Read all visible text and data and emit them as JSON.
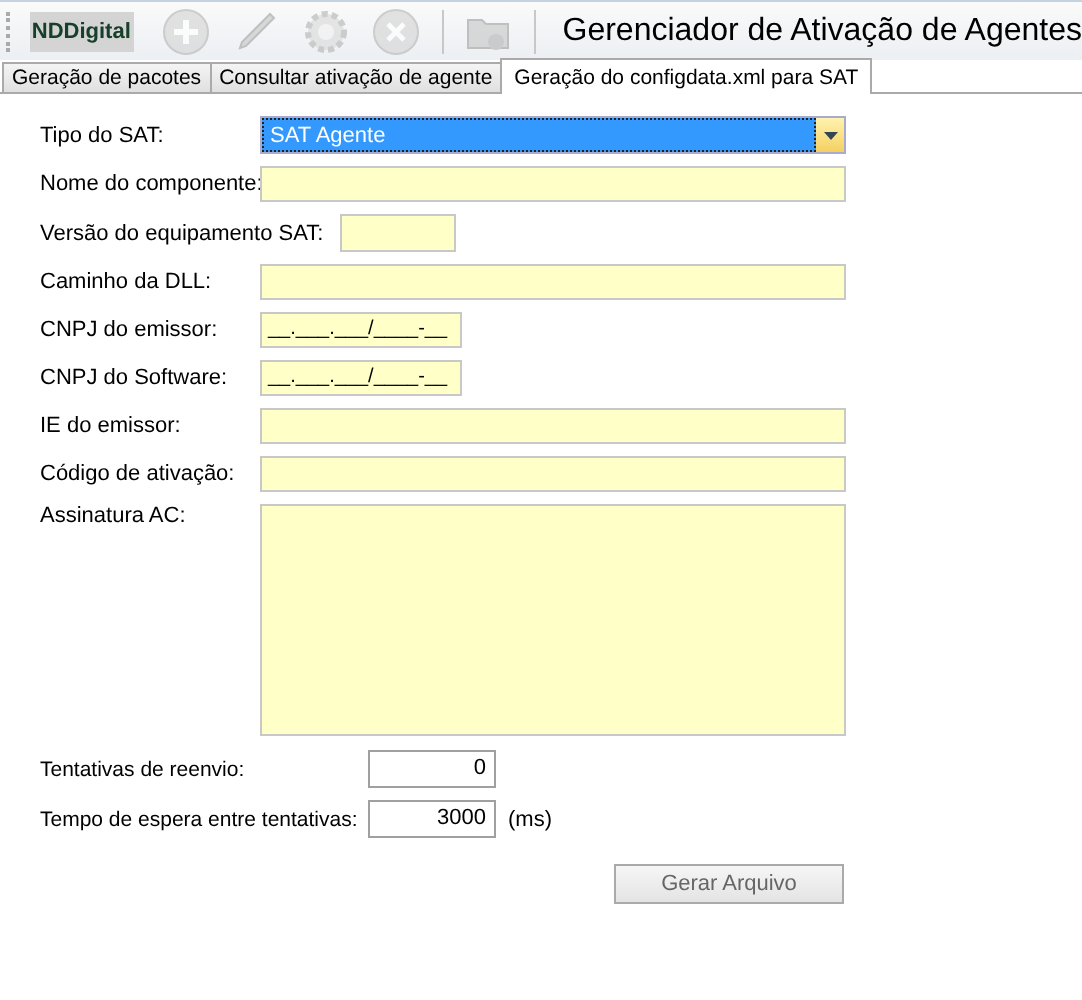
{
  "toolbar": {
    "logo": "NDDigital",
    "tools": [
      {
        "kind": "add",
        "disabled": true
      },
      {
        "kind": "edit",
        "disabled": true
      },
      {
        "kind": "gear",
        "disabled": true
      },
      {
        "kind": "close",
        "disabled": true
      },
      {
        "kind": "folder",
        "disabled": true
      }
    ],
    "title": "Gerenciador de Ativação de Agentes"
  },
  "tabs": [
    {
      "label": "Geração de pacotes",
      "selected": false
    },
    {
      "label": "Consultar ativação de agente",
      "selected": false
    },
    {
      "label": "Geração do configdata.xml para SAT",
      "selected": true
    }
  ],
  "fields": [
    {
      "kind": "select",
      "label": "Tipo do SAT:",
      "value": "SAT Agente"
    },
    {
      "kind": "text",
      "label": "Nome do componente:"
    },
    {
      "kind": "short",
      "label": "Versão do equipamento SAT:"
    },
    {
      "kind": "text",
      "label": "Caminho da DLL:"
    },
    {
      "kind": "mask",
      "label": "CNPJ do emissor:",
      "value": "__.___.___/____-__"
    },
    {
      "kind": "mask",
      "label": "CNPJ do Software:",
      "value": "__.___.___/____-__"
    },
    {
      "kind": "text",
      "label": "IE do emissor:"
    },
    {
      "kind": "text",
      "label": "Código de ativação:"
    },
    {
      "kind": "textarea",
      "label": "Assinatura AC:"
    }
  ],
  "numbers": [
    {
      "label": "Tentativas de reenvio:",
      "value": "0"
    },
    {
      "label": "Tempo de espera entre tentativas:",
      "value": "3000",
      "unit": "(ms)"
    }
  ],
  "button": "Gerar Arquivo"
}
